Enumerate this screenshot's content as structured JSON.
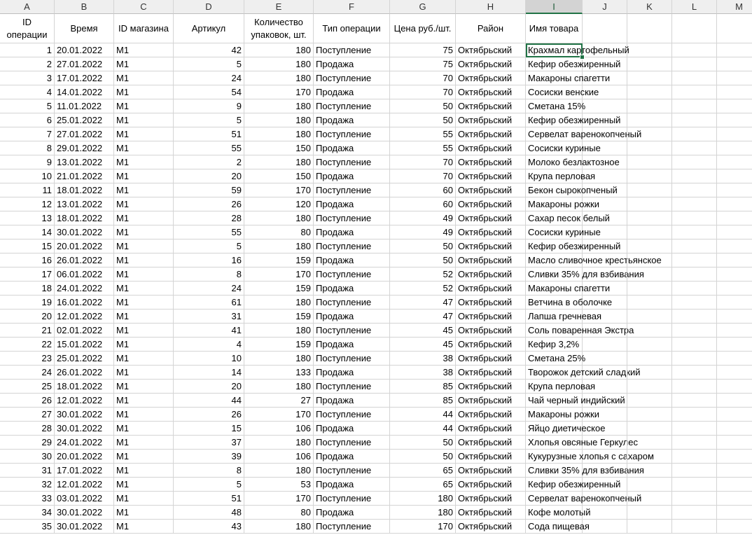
{
  "columns": [
    "A",
    "B",
    "C",
    "D",
    "E",
    "F",
    "G",
    "H",
    "I",
    "J",
    "K",
    "L",
    "M"
  ],
  "active_column": "I",
  "headers": [
    "ID операции",
    "Время",
    "ID магазина",
    "Артикул",
    "Количество упаковок, шт.",
    "Тип операции",
    "Цена руб./шт.",
    "Район",
    "Имя товара"
  ],
  "selected_cell": "I2",
  "rows": [
    [
      "1",
      "20.01.2022",
      "M1",
      "42",
      "180",
      "Поступление",
      "75",
      "Октябрьский",
      "Крахмал картофельный"
    ],
    [
      "2",
      "27.01.2022",
      "M1",
      "5",
      "180",
      "Продажа",
      "75",
      "Октябрьский",
      "Кефир обезжиренный"
    ],
    [
      "3",
      "17.01.2022",
      "M1",
      "24",
      "180",
      "Поступление",
      "70",
      "Октябрьский",
      "Макароны спагетти"
    ],
    [
      "4",
      "14.01.2022",
      "M1",
      "54",
      "170",
      "Продажа",
      "70",
      "Октябрьский",
      "Сосиски венские"
    ],
    [
      "5",
      "11.01.2022",
      "M1",
      "9",
      "180",
      "Поступление",
      "50",
      "Октябрьский",
      "Сметана 15%"
    ],
    [
      "6",
      "25.01.2022",
      "M1",
      "5",
      "180",
      "Продажа",
      "50",
      "Октябрьский",
      "Кефир обезжиренный"
    ],
    [
      "7",
      "27.01.2022",
      "M1",
      "51",
      "180",
      "Поступление",
      "55",
      "Октябрьский",
      "Сервелат варенокопченый"
    ],
    [
      "8",
      "29.01.2022",
      "M1",
      "55",
      "150",
      "Продажа",
      "55",
      "Октябрьский",
      "Сосиски куриные"
    ],
    [
      "9",
      "13.01.2022",
      "M1",
      "2",
      "180",
      "Поступление",
      "70",
      "Октябрьский",
      "Молоко безлактозное"
    ],
    [
      "10",
      "21.01.2022",
      "M1",
      "20",
      "150",
      "Продажа",
      "70",
      "Октябрьский",
      "Крупа перловая"
    ],
    [
      "11",
      "18.01.2022",
      "M1",
      "59",
      "170",
      "Поступление",
      "60",
      "Октябрьский",
      "Бекон сырокопченый"
    ],
    [
      "12",
      "13.01.2022",
      "M1",
      "26",
      "120",
      "Продажа",
      "60",
      "Октябрьский",
      "Макароны рожки"
    ],
    [
      "13",
      "18.01.2022",
      "M1",
      "28",
      "180",
      "Поступление",
      "49",
      "Октябрьский",
      "Сахар песок белый"
    ],
    [
      "14",
      "30.01.2022",
      "M1",
      "55",
      "80",
      "Продажа",
      "49",
      "Октябрьский",
      "Сосиски куриные"
    ],
    [
      "15",
      "20.01.2022",
      "M1",
      "5",
      "180",
      "Поступление",
      "50",
      "Октябрьский",
      "Кефир обезжиренный"
    ],
    [
      "16",
      "26.01.2022",
      "M1",
      "16",
      "159",
      "Продажа",
      "50",
      "Октябрьский",
      "Масло сливочное крестьянское"
    ],
    [
      "17",
      "06.01.2022",
      "M1",
      "8",
      "170",
      "Поступление",
      "52",
      "Октябрьский",
      "Сливки 35% для взбивания"
    ],
    [
      "18",
      "24.01.2022",
      "M1",
      "24",
      "159",
      "Продажа",
      "52",
      "Октябрьский",
      "Макароны спагетти"
    ],
    [
      "19",
      "16.01.2022",
      "M1",
      "61",
      "180",
      "Поступление",
      "47",
      "Октябрьский",
      "Ветчина в оболочке"
    ],
    [
      "20",
      "12.01.2022",
      "M1",
      "31",
      "159",
      "Продажа",
      "47",
      "Октябрьский",
      "Лапша гречневая"
    ],
    [
      "21",
      "02.01.2022",
      "M1",
      "41",
      "180",
      "Поступление",
      "45",
      "Октябрьский",
      "Соль поваренная Экстра"
    ],
    [
      "22",
      "15.01.2022",
      "M1",
      "4",
      "159",
      "Продажа",
      "45",
      "Октябрьский",
      "Кефир 3,2%"
    ],
    [
      "23",
      "25.01.2022",
      "M1",
      "10",
      "180",
      "Поступление",
      "38",
      "Октябрьский",
      "Сметана 25%"
    ],
    [
      "24",
      "26.01.2022",
      "M1",
      "14",
      "133",
      "Продажа",
      "38",
      "Октябрьский",
      "Творожок детский сладкий"
    ],
    [
      "25",
      "18.01.2022",
      "M1",
      "20",
      "180",
      "Поступление",
      "85",
      "Октябрьский",
      "Крупа перловая"
    ],
    [
      "26",
      "12.01.2022",
      "M1",
      "44",
      "27",
      "Продажа",
      "85",
      "Октябрьский",
      "Чай черный индийский"
    ],
    [
      "27",
      "30.01.2022",
      "M1",
      "26",
      "170",
      "Поступление",
      "44",
      "Октябрьский",
      "Макароны рожки"
    ],
    [
      "28",
      "30.01.2022",
      "M1",
      "15",
      "106",
      "Продажа",
      "44",
      "Октябрьский",
      "Яйцо диетическое"
    ],
    [
      "29",
      "24.01.2022",
      "M1",
      "37",
      "180",
      "Поступление",
      "50",
      "Октябрьский",
      "Хлопья овсяные Геркулес"
    ],
    [
      "30",
      "20.01.2022",
      "M1",
      "39",
      "106",
      "Продажа",
      "50",
      "Октябрьский",
      "Кукурузные хлопья с сахаром"
    ],
    [
      "31",
      "17.01.2022",
      "M1",
      "8",
      "180",
      "Поступление",
      "65",
      "Октябрьский",
      "Сливки 35% для взбивания"
    ],
    [
      "32",
      "12.01.2022",
      "M1",
      "5",
      "53",
      "Продажа",
      "65",
      "Октябрьский",
      "Кефир обезжиренный"
    ],
    [
      "33",
      "03.01.2022",
      "M1",
      "51",
      "170",
      "Поступление",
      "180",
      "Октябрьский",
      "Сервелат варенокопченый"
    ],
    [
      "34",
      "30.01.2022",
      "M1",
      "48",
      "80",
      "Продажа",
      "180",
      "Октябрьский",
      "Кофе молотый"
    ],
    [
      "35",
      "30.01.2022",
      "M1",
      "43",
      "180",
      "Поступление",
      "170",
      "Октябрьский",
      "Сода пищевая"
    ]
  ],
  "colors": {
    "selection": "#217346",
    "header_bg": "#efefef",
    "grid": "#d4d4d4"
  }
}
